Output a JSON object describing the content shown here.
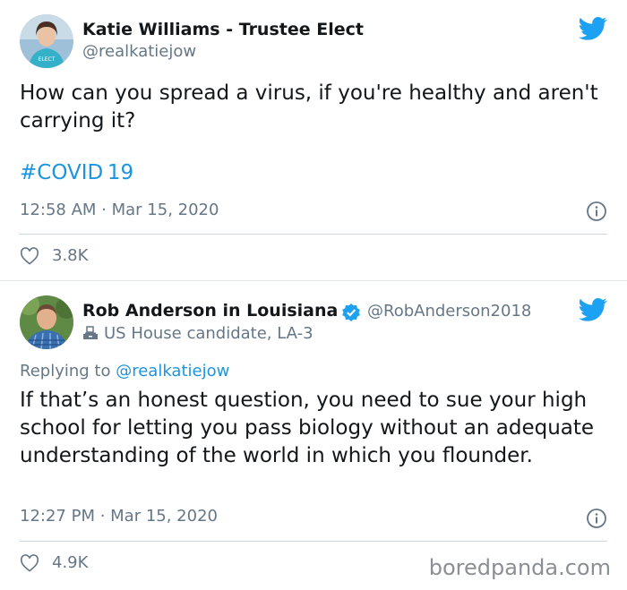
{
  "tweet1": {
    "name": "Katie Williams - Trustee Elect",
    "handle": "@realkatiejow",
    "text": "How can you spread a virus, if you're healthy and aren't carrying it?",
    "hashtag": "#COVID 19",
    "timestamp": "12:58 AM · Mar 15, 2020",
    "likes": "3.8K"
  },
  "tweet2": {
    "name": "Rob Anderson in Louisiana",
    "handle": "@RobAnderson2018",
    "bio": "US House candidate, LA-3",
    "replying_to_prefix": "Replying to",
    "replying_to_handle": "@realkatiejow",
    "text": "If that’s an honest question, you need to sue your high school for letting you pass biology without an adequate understanding of the world in which you flounder.",
    "timestamp": "12:27 PM · Mar 15, 2020",
    "likes": "4.9K"
  },
  "watermark": "boredpanda.com",
  "colors": {
    "accent": "#1da1f2",
    "link": "#1b95e0",
    "muted": "#657786"
  }
}
